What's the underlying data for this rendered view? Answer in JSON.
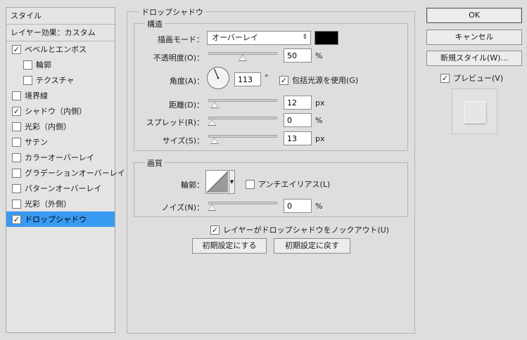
{
  "style_list": {
    "header": "スタイル",
    "effect_header": "レイヤー効果：カスタム",
    "items": [
      {
        "label": "ベベルとエンボス",
        "checked": true
      },
      {
        "label": "輪郭",
        "checked": false
      },
      {
        "label": "テクスチャ",
        "checked": false
      },
      {
        "label": "境界線",
        "checked": false
      },
      {
        "label": "シャドウ（内側）",
        "checked": true
      },
      {
        "label": "光彩（内側）",
        "checked": false
      },
      {
        "label": "サテン",
        "checked": false
      },
      {
        "label": "カラーオーバーレイ",
        "checked": false
      },
      {
        "label": "グラデーションオーバーレイ",
        "checked": false
      },
      {
        "label": "パターンオーバーレイ",
        "checked": false
      },
      {
        "label": "光彩（外側）",
        "checked": false
      },
      {
        "label": "ドロップシャドウ",
        "checked": true
      }
    ]
  },
  "panel": {
    "title": "ドロップシャドウ",
    "structure": {
      "title": "構造",
      "blend_mode_label": "描画モード：",
      "blend_mode_value": "オーバーレイ",
      "shadow_color": "#000000",
      "opacity_label": "不透明度(O)：",
      "opacity_value": "50",
      "opacity_unit": "%",
      "opacity_fraction": 0.5,
      "angle_label": "角度(A)：",
      "angle_value": "113",
      "angle_unit": "°",
      "global_light_label": "包括光源を使用(G)",
      "global_light_checked": true,
      "distance_label": "距離(D)：",
      "distance_value": "12",
      "distance_unit": "px",
      "distance_fraction": 0.04,
      "spread_label": "スプレッド(R)：",
      "spread_value": "0",
      "spread_unit": "%",
      "spread_fraction": 0.0,
      "size_label": "サイズ(S)：",
      "size_value": "13",
      "size_unit": "px",
      "size_fraction": 0.05
    },
    "quality": {
      "title": "画質",
      "contour_label": "輪郭：",
      "antialias_label": "アンチエイリアス(L)",
      "antialias_checked": false,
      "noise_label": "ノイズ(N)：",
      "noise_value": "0",
      "noise_unit": "%",
      "noise_fraction": 0.0
    },
    "knockout_label": "レイヤーがドロップシャドウをノックアウト(U)",
    "knockout_checked": true,
    "make_default_label": "初期設定にする",
    "reset_default_label": "初期設定に戻す"
  },
  "right": {
    "ok_label": "OK",
    "cancel_label": "キャンセル",
    "new_style_label": "新規スタイル(W)...",
    "preview_label": "プレビュー(V)",
    "preview_checked": true
  }
}
